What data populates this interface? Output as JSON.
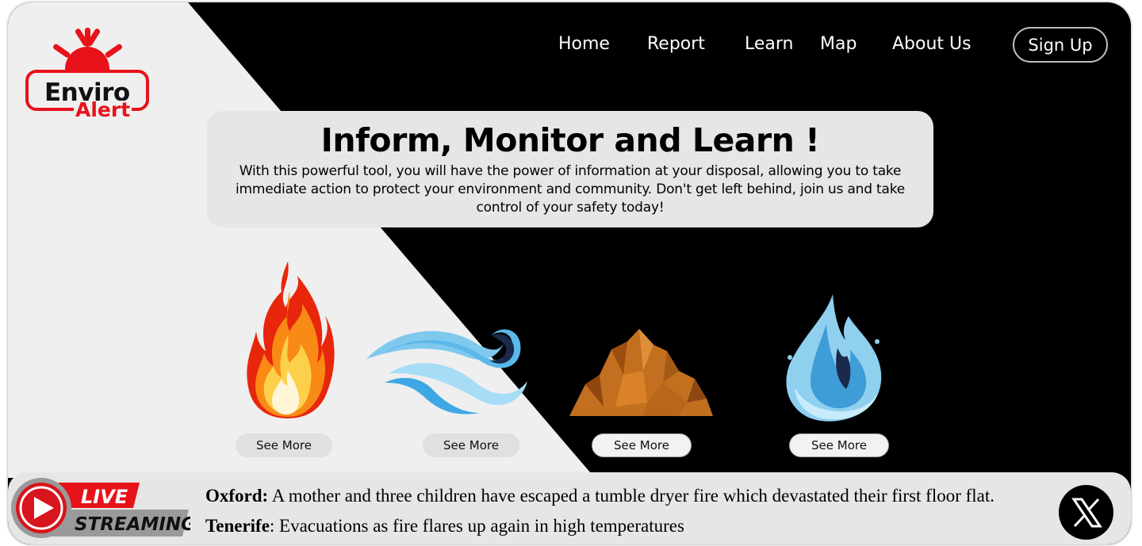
{
  "logo": {
    "line1": "Enviro",
    "line2": "Alert"
  },
  "nav": {
    "items": [
      {
        "label": "Home"
      },
      {
        "label": "Report"
      },
      {
        "label": "Learn"
      },
      {
        "label": "Map"
      },
      {
        "label": "About Us"
      }
    ],
    "signup_label": "Sign Up"
  },
  "hero": {
    "title": "Inform, Monitor and Learn !",
    "body": "With this powerful tool, you will have the power of information at your disposal, allowing you to take immediate action to protect your environment and community. Don't get left behind, join us and take control of your safety today!"
  },
  "elements": [
    {
      "icon": "fire-icon",
      "button_label": "See More"
    },
    {
      "icon": "wind-icon",
      "button_label": "See More"
    },
    {
      "icon": "earth-icon",
      "button_label": "See More"
    },
    {
      "icon": "water-icon",
      "button_label": "See More"
    }
  ],
  "ticker": {
    "badge_line1": "LIVE",
    "badge_line2": "STREAMING",
    "news": [
      {
        "place": "Oxford:",
        "text": " A mother and three children have escaped a tumble dryer fire which devastated their first floor flat."
      },
      {
        "place": "Tenerife",
        "text": ": Evacuations as fire flares up again in high temperatures"
      }
    ]
  },
  "colors": {
    "brand_red": "#e8121a",
    "background_dark": "#000000",
    "background_light": "#efefef",
    "panel": "#e6e6e6"
  }
}
